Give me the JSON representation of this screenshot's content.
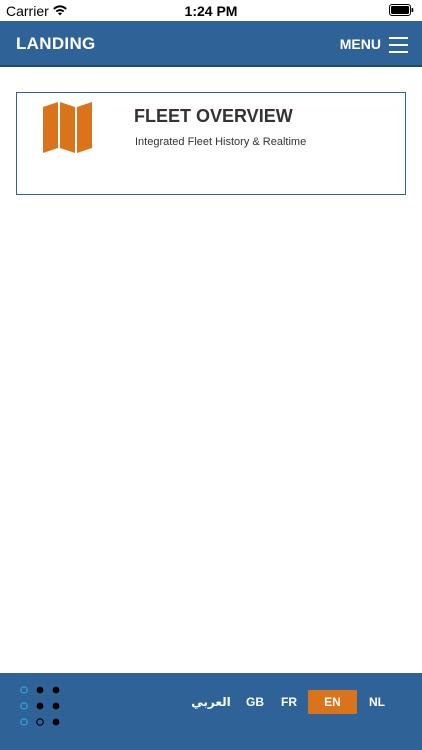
{
  "status_bar": {
    "carrier": "Carrier",
    "time": "1:24 PM"
  },
  "header": {
    "title": "LANDING",
    "menu_label": "MENU"
  },
  "card": {
    "title": "FLEET OVERVIEW",
    "subtitle": "Integrated Fleet History & Realtime",
    "icon": "map-icon",
    "icon_color": "#d9741a"
  },
  "footer": {
    "languages": [
      "العربي",
      "GB",
      "FR",
      "EN",
      "NL"
    ],
    "selected_language": "EN"
  },
  "colors": {
    "primary": "#2f6397",
    "accent": "#d9741a",
    "text": "#333333"
  }
}
